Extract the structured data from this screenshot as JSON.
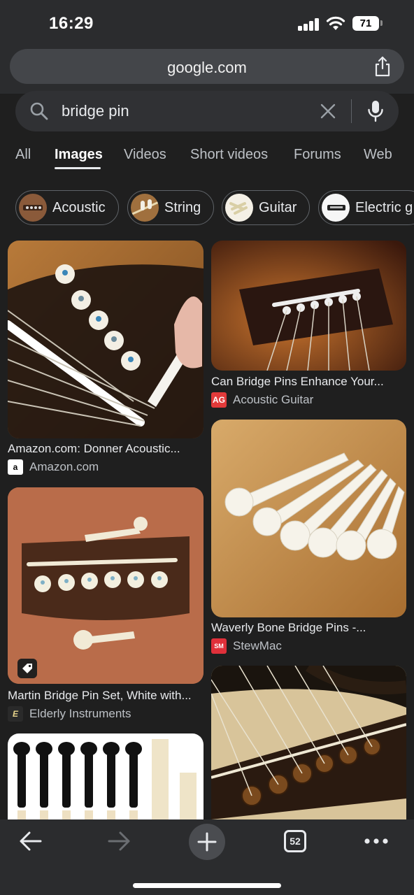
{
  "status_bar": {
    "time": "16:29",
    "battery": "71"
  },
  "url_bar": {
    "domain": "google.com",
    "share_icon": "share-icon"
  },
  "search": {
    "query": "bridge pin"
  },
  "tabs": [
    {
      "label": "All"
    },
    {
      "label": "Images",
      "active": true
    },
    {
      "label": "Videos"
    },
    {
      "label": "Short videos"
    },
    {
      "label": "Forums"
    },
    {
      "label": "Web"
    }
  ],
  "chips": [
    {
      "label": "Acoustic"
    },
    {
      "label": "String"
    },
    {
      "label": "Guitar"
    },
    {
      "label": "Electric g"
    }
  ],
  "results": [
    {
      "title": "Amazon.com: Donner Acoustic...",
      "source": "Amazon.com",
      "favicon": "a"
    },
    {
      "title": "Can Bridge Pins Enhance Your...",
      "source": "Acoustic Guitar",
      "favicon": "AG"
    },
    {
      "title": "Waverly Bone Bridge Pins -...",
      "source": "StewMac",
      "favicon": "SM"
    },
    {
      "title": "Martin Bridge Pin Set, White with...",
      "source": "Elderly Instruments",
      "favicon": "E"
    }
  ],
  "toolbar": {
    "tab_count": "52"
  },
  "colors": {
    "background": "#1f1f1f",
    "chrome": "#2b2c2e",
    "search_bg": "#303134",
    "text": "#e8eaed"
  }
}
